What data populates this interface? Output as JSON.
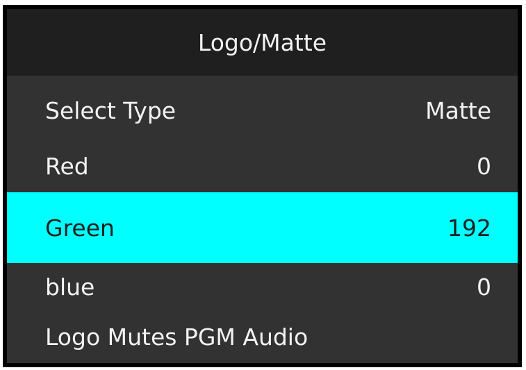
{
  "menu": {
    "title": "Logo/Matte",
    "items": [
      {
        "label": "Select Type",
        "value": "Matte"
      },
      {
        "label": "Red",
        "value": "0"
      },
      {
        "label": "Green",
        "value": "192"
      },
      {
        "label": "blue",
        "value": "0"
      },
      {
        "label": "Logo Mutes PGM Audio",
        "value": ""
      }
    ],
    "selected_index": 2
  },
  "colors": {
    "panel_background": "#323232",
    "title_background": "#1f1f1f",
    "highlight": "#00ffff",
    "text": "#f2f2f2",
    "frame": "#000000"
  }
}
